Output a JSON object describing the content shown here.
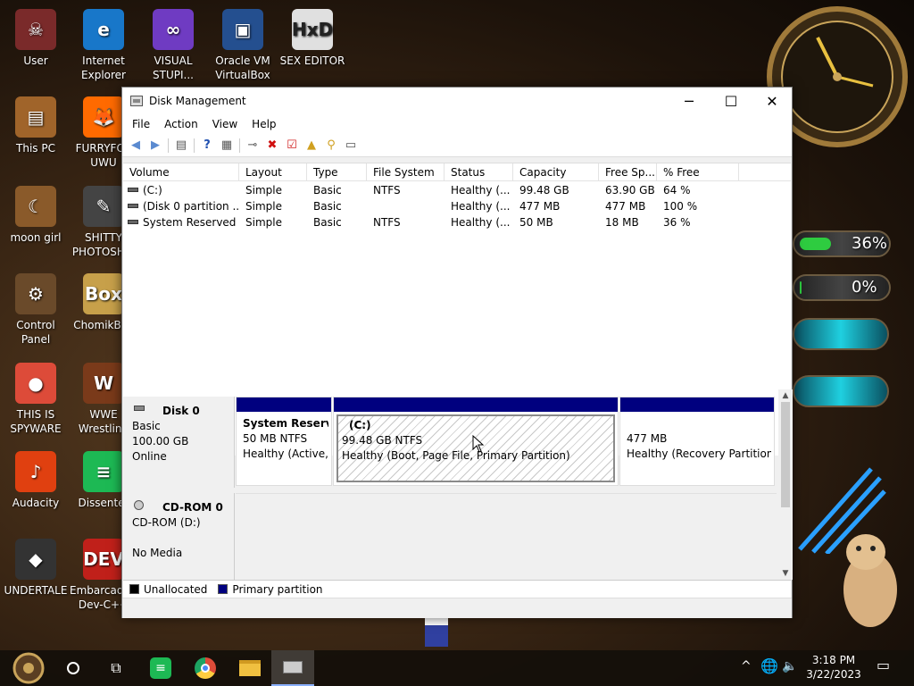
{
  "desktop": {
    "icons": [
      {
        "label": "User",
        "color": "#7a2a2a",
        "glyph": "☠"
      },
      {
        "label": "Internet Explorer",
        "color": "#1877c9",
        "glyph": "e"
      },
      {
        "label": "VISUAL STUPI...",
        "color": "#6f3bc2",
        "glyph": "∞"
      },
      {
        "label": "Oracle VM VirtualBox",
        "color": "#244f8f",
        "glyph": "▣"
      },
      {
        "label": "SEX EDITOR",
        "color": "#e0e0e0",
        "glyph": "HxD"
      },
      {
        "label": "This PC",
        "color": "#a0642a",
        "glyph": "▤"
      },
      {
        "label": "FURRYFOX UWU",
        "color": "#ff6a00",
        "glyph": "🦊"
      },
      {
        "label": "moon girl",
        "color": "#8a5a2a",
        "glyph": "☾"
      },
      {
        "label": "SHITTY PHOTOSH...",
        "color": "#444444",
        "glyph": "✎"
      },
      {
        "label": "Control Panel",
        "color": "#6a4a2a",
        "glyph": "⚙"
      },
      {
        "label": "ChomikBox",
        "color": "#c7a04a",
        "glyph": "Box"
      },
      {
        "label": "THIS IS SPYWARE",
        "color": "#dd4b39",
        "glyph": "●"
      },
      {
        "label": "WWE Wrestling",
        "color": "#7a3a1a",
        "glyph": "W"
      },
      {
        "label": "Audacity",
        "color": "#e04010",
        "glyph": "♪"
      },
      {
        "label": "Dissenter",
        "color": "#1db954",
        "glyph": "≡"
      },
      {
        "label": "UNDERTALE",
        "color": "#333333",
        "glyph": "◆"
      },
      {
        "label": "Embarcadero Dev-C++",
        "color": "#c0201a",
        "glyph": "DEV"
      }
    ],
    "gauges": [
      {
        "text": "36%",
        "level": 0.36,
        "color": "#2ecc40"
      },
      {
        "text": "0%",
        "level": 0.0,
        "color": "#2ecc40"
      }
    ]
  },
  "window": {
    "title": "Disk Management",
    "controls": {
      "minimize": "─",
      "maximize": "☐",
      "close": "✕"
    },
    "menu": [
      "File",
      "Action",
      "View",
      "Help"
    ],
    "volumes": {
      "columns": [
        "Volume",
        "Layout",
        "Type",
        "File System",
        "Status",
        "Capacity",
        "Free Sp...",
        "% Free"
      ],
      "rows": [
        [
          "(C:)",
          "Simple",
          "Basic",
          "NTFS",
          "Healthy (...",
          "99.48 GB",
          "63.90 GB",
          "64 %"
        ],
        [
          "(Disk 0 partition ...",
          "Simple",
          "Basic",
          "",
          "Healthy (...",
          "477 MB",
          "477 MB",
          "100 %"
        ],
        [
          "System Reserved ...",
          "Simple",
          "Basic",
          "NTFS",
          "Healthy (...",
          "50 MB",
          "18 MB",
          "36 %"
        ]
      ]
    },
    "disks": {
      "disk0": {
        "name": "Disk 0",
        "type": "Basic",
        "size": "100.00 GB",
        "state": "Online",
        "partitions": [
          {
            "name": "System Reserve",
            "size": "50 MB NTFS",
            "status": "Healthy (Active,"
          },
          {
            "name": "(C:)",
            "size": "99.48 GB NTFS",
            "status": "Healthy (Boot, Page File, Primary Partition)"
          },
          {
            "name": "",
            "size": "477 MB",
            "status": "Healthy (Recovery Partition)"
          }
        ]
      },
      "cdrom0": {
        "name": "CD-ROM 0",
        "drive": "CD-ROM (D:)",
        "media": "No Media"
      }
    },
    "legend": [
      {
        "label": "Unallocated",
        "color": "#000000"
      },
      {
        "label": "Primary partition",
        "color": "#00007f"
      }
    ]
  },
  "taskbar": {
    "time": "3:18 PM",
    "date": "3/22/2023"
  }
}
